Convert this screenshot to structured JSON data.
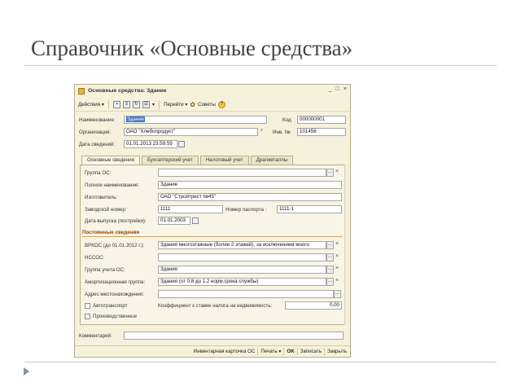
{
  "slide": {
    "title": "Справочник «Основные средства»"
  },
  "window": {
    "title": "Основные средства: Здание",
    "controls": [
      "_",
      "□",
      "×"
    ]
  },
  "toolbar": {
    "actions": "Действия",
    "goto": "Перейти",
    "tips": "Советы",
    "help": "?"
  },
  "header": {
    "name_label": "Наименование:",
    "name_value": "Здание",
    "code_label": "Код:",
    "code_value": "000000001",
    "org_label": "Организация:",
    "org_value": "ОАО \"Хлебопродукт\"",
    "inv_label": "Инв. №:",
    "inv_value": "101456",
    "date_label": "Дата сведений:",
    "date_value": "01.01.2013 23:59:59"
  },
  "tabs": [
    "Основные сведения",
    "Бухгалтерский учет",
    "Налоговый учет",
    "Драгметаллы"
  ],
  "main": {
    "group_label": "Группа ОС:",
    "group_value": "",
    "fullname_label": "Полное наименование:",
    "fullname_value": "Здание",
    "maker_label": "Изготовитель:",
    "maker_value": "ОАО \"Стройтрест №45\"",
    "serial_label": "Заводской номер:",
    "serial_value": "1111",
    "passport_label": "Номер паспорта :",
    "passport_value": "1111-1",
    "release_label": "Дата выпуска (постройки):",
    "release_value": "01.01.2003"
  },
  "constant": {
    "title": "Постоянные сведения",
    "okof_label": "ВРКОС (до 01.01.2012 г.):",
    "okof_value": "Здания многоэтажные (более 2 этажей), за исключением много",
    "nsos_label": "НССОС:",
    "nsos_value": "",
    "acc_group_label": "Группа учета ОС:",
    "acc_group_value": "Здания",
    "amort_label": "Амортизационная группа:",
    "amort_value": "Здания (от 0.8 до 1.2 норм.срока службы)",
    "address_label": "Адрес местонахождения:",
    "address_value": "",
    "auto_label": "Автотранспорт",
    "coef_label": "Коэффициент к ставке налога на недвижимость:",
    "coef_value": "0,00",
    "production_label": "Производственное"
  },
  "comment": {
    "label": "Комментарий:",
    "value": ""
  },
  "bottom": {
    "inv_card": "Инвентарная карточка ОС",
    "print": "Печать",
    "ok": "OK",
    "save": "Записать",
    "close": "Закрыть"
  }
}
